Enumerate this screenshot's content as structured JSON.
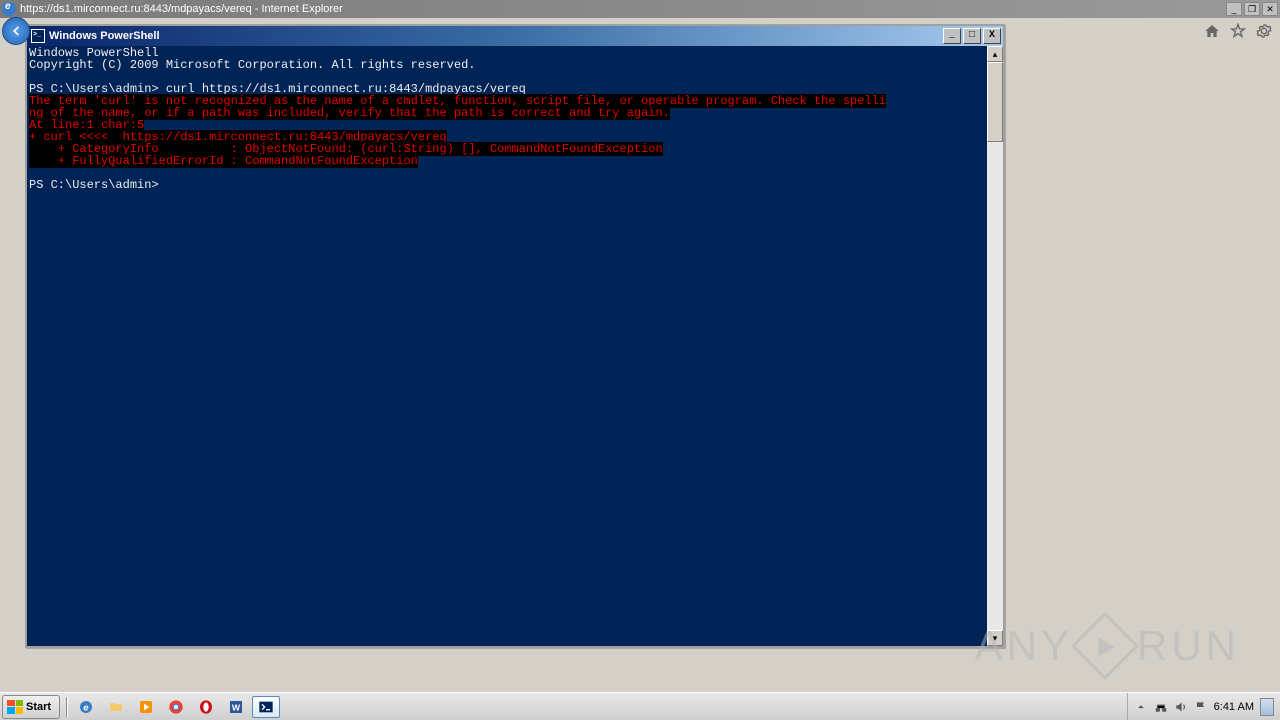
{
  "browser": {
    "title": "https://ds1.mirconnect.ru:8443/mdpayacs/vereq - Internet Explorer"
  },
  "powershell": {
    "title": "Windows PowerShell",
    "header_line1": "Windows PowerShell",
    "header_line2": "Copyright (C) 2009 Microsoft Corporation. All rights reserved.",
    "prompt1": "PS C:\\Users\\admin> ",
    "command1": "curl https://ds1.mirconnect.ru:8443/mdpayacs/vereq",
    "error_line1": "The term 'curl' is not recognized as the name of a cmdlet, function, script file, or operable program. Check the spelli",
    "error_line2": "ng of the name, or if a path was included, verify that the path is correct and try again.",
    "error_line3": "At line:1 char:5",
    "error_line4": "+ curl <<<<  https://ds1.mirconnect.ru:8443/mdpayacs/vereq",
    "error_line5": "    + CategoryInfo          : ObjectNotFound: (curl:String) [], CommandNotFoundException",
    "error_line6": "    + FullyQualifiedErrorId : CommandNotFoundException",
    "prompt2": "PS C:\\Users\\admin>"
  },
  "taskbar": {
    "start_label": "Start",
    "clock": "6:41 AM"
  },
  "watermark": {
    "left": "ANY",
    "right": "RUN"
  }
}
